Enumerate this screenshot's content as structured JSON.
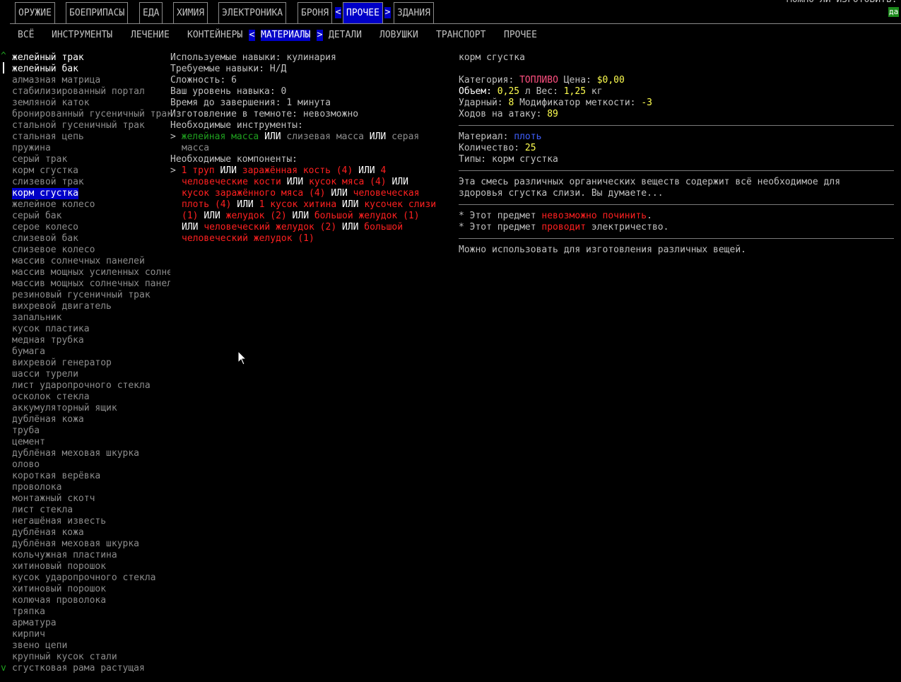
{
  "top_tabs": [
    {
      "label": "ОРУЖИЕ"
    },
    {
      "label": "БОЕПРИПАСЫ"
    },
    {
      "label": "ЕДА"
    },
    {
      "label": "ХИМИЯ"
    },
    {
      "label": "ЭЛЕКТРОНИКА"
    },
    {
      "label": "БРОНЯ"
    },
    {
      "label": "ПРОЧЕЕ"
    },
    {
      "label": "ЗДАНИЯ"
    }
  ],
  "tab_arrow_left": "<",
  "tab_arrow_right": ">",
  "craftable_label": "МОЖНО ЛИ ИЗГОТОВИТЬ:",
  "craftable_badge": "да",
  "sub_tabs": [
    {
      "label": "ВСЁ"
    },
    {
      "label": "ИНСТРУМЕНТЫ"
    },
    {
      "label": "ЛЕЧЕНИЕ"
    },
    {
      "label": "КОНТЕЙНЕРЫ"
    },
    {
      "label": "МАТЕРИАЛЫ"
    },
    {
      "label": "ДЕТАЛИ"
    },
    {
      "label": "ЛОВУШКИ"
    },
    {
      "label": "ТРАНСПОРТ"
    },
    {
      "label": "ПРОЧЕЕ"
    }
  ],
  "scroll_up": "^",
  "scroll_down": "v",
  "items": [
    "желейный трак",
    "желейный бак",
    "алмазная матрица",
    "стабилизированный портал",
    "земляной каток",
    "бронированный гусеничный трак",
    "стальной гусеничный трак",
    "стальная цепь",
    "пружина",
    "серый трак",
    "корм сгустка",
    "слизевой трак",
    "корм сгустка",
    "желейное колесо",
    "серый бак",
    "серое колесо",
    "слизевой бак",
    "слизевое колесо",
    "массив солнечных панелей",
    "массив мощных усиленных солнечных панелей",
    "массив мощных солнечных панелей",
    "резиновый гусеничный трак",
    "вихревой двигатель",
    "запальник",
    "кусок пластика",
    "медная трубка",
    "бумага",
    "вихревой генератор",
    "шасси турели",
    "лист ударопрочного стекла",
    "осколок стекла",
    "аккумуляторный ящик",
    "дублёная кожа",
    "труба",
    "цемент",
    "дублёная меховая шкурка",
    "олово",
    "короткая верёвка",
    "проволока",
    "монтажный скотч",
    "лист стекла",
    "негашёная известь",
    "дублёная кожа",
    "дублёная меховая шкурка",
    "кольчужная пластина",
    "хитиновый порошок",
    "кусок ударопрочного стекла",
    "хитиновый порошок",
    "колючая проволока",
    "тряпка",
    "арматура",
    "кирпич",
    "звено цепи",
    "крупный кусок стали",
    "сгустковая рама растущая"
  ],
  "recipe": {
    "skills_used_label": "Используемые навыки:",
    "skills_used": "кулинария",
    "skills_required_label": "Требуемые навыки:",
    "skills_required": "Н/Д",
    "difficulty_label": "Сложность:",
    "difficulty": "6",
    "your_level_label": "Ваш уровень навыка:",
    "your_level": "0",
    "time_label": "Время до завершения:",
    "time": "1 минута",
    "dark_label": "Изготовление в темноте:",
    "dark": "невозможно",
    "tools_label": "Необходимые инструменты:",
    "bullet": ">",
    "or": "ИЛИ",
    "tool_1": "желейная масса",
    "tool_2": "слизевая масса",
    "tool_3a": "серая",
    "tool_3b": "масса",
    "components_label": "Необходимые компоненты:",
    "c1": "1 труп",
    "c2": "заражённая кость (4)",
    "c3a": "4",
    "c3b": "человеческие кости",
    "c4": "кусок мяса (4)",
    "c5": "кусок заражённого мяса (4)",
    "c6a": "человеческая",
    "c6b": "плоть (4)",
    "c7": "1 кусок хитина",
    "c8a": "кусочек слизи",
    "c8b": "(1)",
    "c9": "желудок (2)",
    "c10": "большой желудок (1)",
    "c11": "человеческий желудок (2)",
    "c12a": "большой",
    "c12b": "человеческий желудок (1)"
  },
  "details": {
    "name": "корм сгустка",
    "category_label": "Категория:",
    "category": "ТОПЛИВО",
    "price_label": "Цена:",
    "price": "$0,00",
    "volume_label": "Объем:",
    "volume": "0,25",
    "volume_unit": "л",
    "weight_label": "Вес:",
    "weight": "1,25",
    "weight_unit": "кг",
    "bash_label": "Ударный:",
    "bash": "8",
    "acc_label": "Модификатор меткости:",
    "acc": "-3",
    "moves_label": "Ходов на атаку:",
    "moves": "89",
    "material_label": "Материал:",
    "material": "плоть",
    "count_label": "Количество:",
    "count": "25",
    "types_label": "Типы:",
    "types": "корм сгустка",
    "desc_1": "Эта смесь различных органических веществ содержит всё необходимое для",
    "desc_2": "здоровья сгустка слизи. Вы думаете...",
    "note1_a": "* Этот предмет",
    "note1_b": "невозможно починить",
    "note2_a": "* Этот предмет",
    "note2_b": "проводит",
    "note2_c": "электричество.",
    "dot": ".",
    "usage": "Можно использовать для изготовления различных вещей."
  },
  "colors": {
    "accent": "#0000c8",
    "badge": "#1c8a1c",
    "red": "#ff2020",
    "green": "#1fa01f",
    "yellow": "#ffff50",
    "pink": "#ff5080",
    "blue": "#4060ff"
  }
}
